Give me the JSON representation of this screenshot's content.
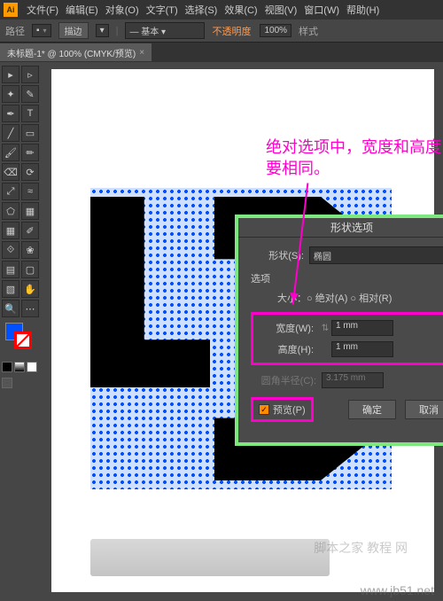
{
  "menubar": {
    "items": [
      "文件(F)",
      "编辑(E)",
      "对象(O)",
      "文字(T)",
      "选择(S)",
      "效果(C)",
      "视图(V)",
      "窗口(W)",
      "帮助(H)"
    ],
    "ai": "Ai"
  },
  "optionbar": {
    "label": "路径",
    "edit_btn": "描边",
    "stroke_drop": "▾",
    "basic_drop": "— 基本 ▾",
    "opacity_label": "不透明度",
    "opacity_value": "100%",
    "style_label": "样式"
  },
  "tab": {
    "title": "未标题-1* @ 100% (CMYK/预览)",
    "close": "×"
  },
  "annotation": {
    "line1": "绝对选项中，宽度和高度",
    "line2": "要相同。"
  },
  "panel": {
    "title": "形状选项",
    "shape_label": "形状(S):",
    "shape_value": "椭圆",
    "options_label": "选项",
    "size_abs": "大小：○ 绝对(A)  ○ 相对(R)",
    "width_label": "宽度(W):",
    "width_value": "1 mm",
    "height_label": "高度(H):",
    "height_value": "1 mm",
    "corner_label": "圆角半径(C):",
    "corner_value": "3.175 mm",
    "preview_label": "预览(P)",
    "ok": "确定",
    "cancel": "取消"
  },
  "watermark": {
    "bottom": "www.jb51.net",
    "mid": "脚本之家 教程 网"
  },
  "tools": {
    "selection": "▸",
    "direct": "▹",
    "wand": "✦",
    "lasso": "✎",
    "pen": "✒",
    "type": "T",
    "line": "╱",
    "rect": "▭",
    "brush": "🖌",
    "pencil": "✏",
    "eraser": "⌫",
    "rotate": "⟳",
    "scale": "⤢",
    "width": "≈",
    "shape": "⬠",
    "gradient": "▦",
    "mesh": "▦",
    "eyedrop": "✐",
    "blend": "⟐",
    "symbol": "❀",
    "graph": "▤",
    "artb": "▢",
    "slice": "▧",
    "hand": "✋",
    "zoom": "🔍"
  }
}
